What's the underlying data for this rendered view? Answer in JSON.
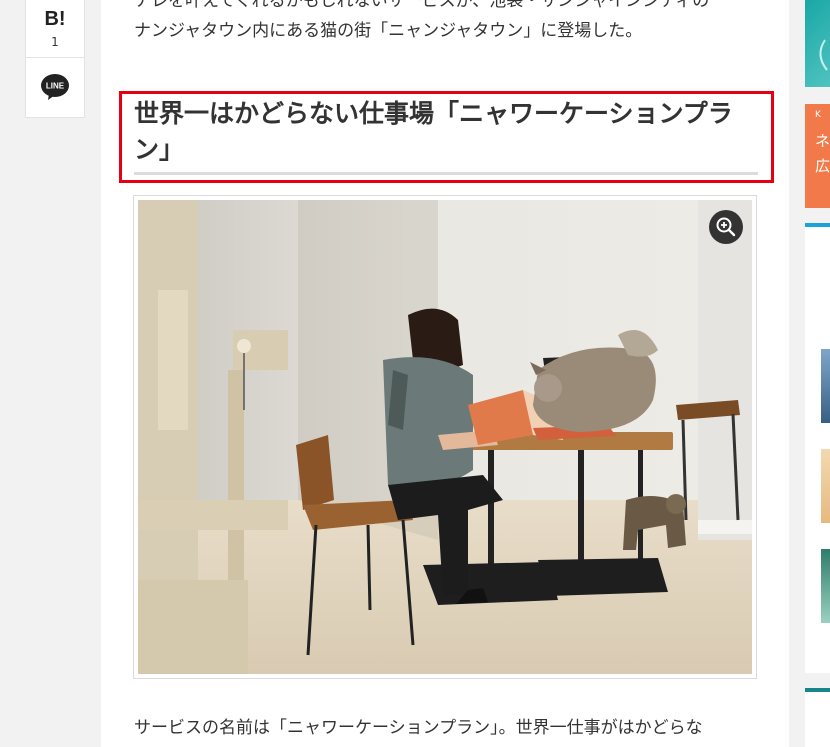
{
  "share": {
    "hatena_label": "B!",
    "hatena_count": "1",
    "line_label": "LINE"
  },
  "article": {
    "lines_before": [
      "ナレを叶えてくれるかもしれないサービスが、池袋・サンシャインシティの",
      "ナンジャタウン内にある猫の街「ニャンジャタウン」に登場した。"
    ],
    "heading": "世界一はかどらない仕事場「ニャワーケーションプラン」",
    "figure_action": "zoom-in",
    "paragraph_after": "サービスの名前は「ニャワーケーションプラン」。世界一仕事がはかどらな"
  },
  "sidebar": {
    "ad_text_1": "K",
    "ad_text_2": "ネ",
    "ad_text_3": "広"
  },
  "colors": {
    "highlight": "#e60012",
    "accent_teal": "#17a3a5",
    "ad_orange": "#f27a4a"
  }
}
